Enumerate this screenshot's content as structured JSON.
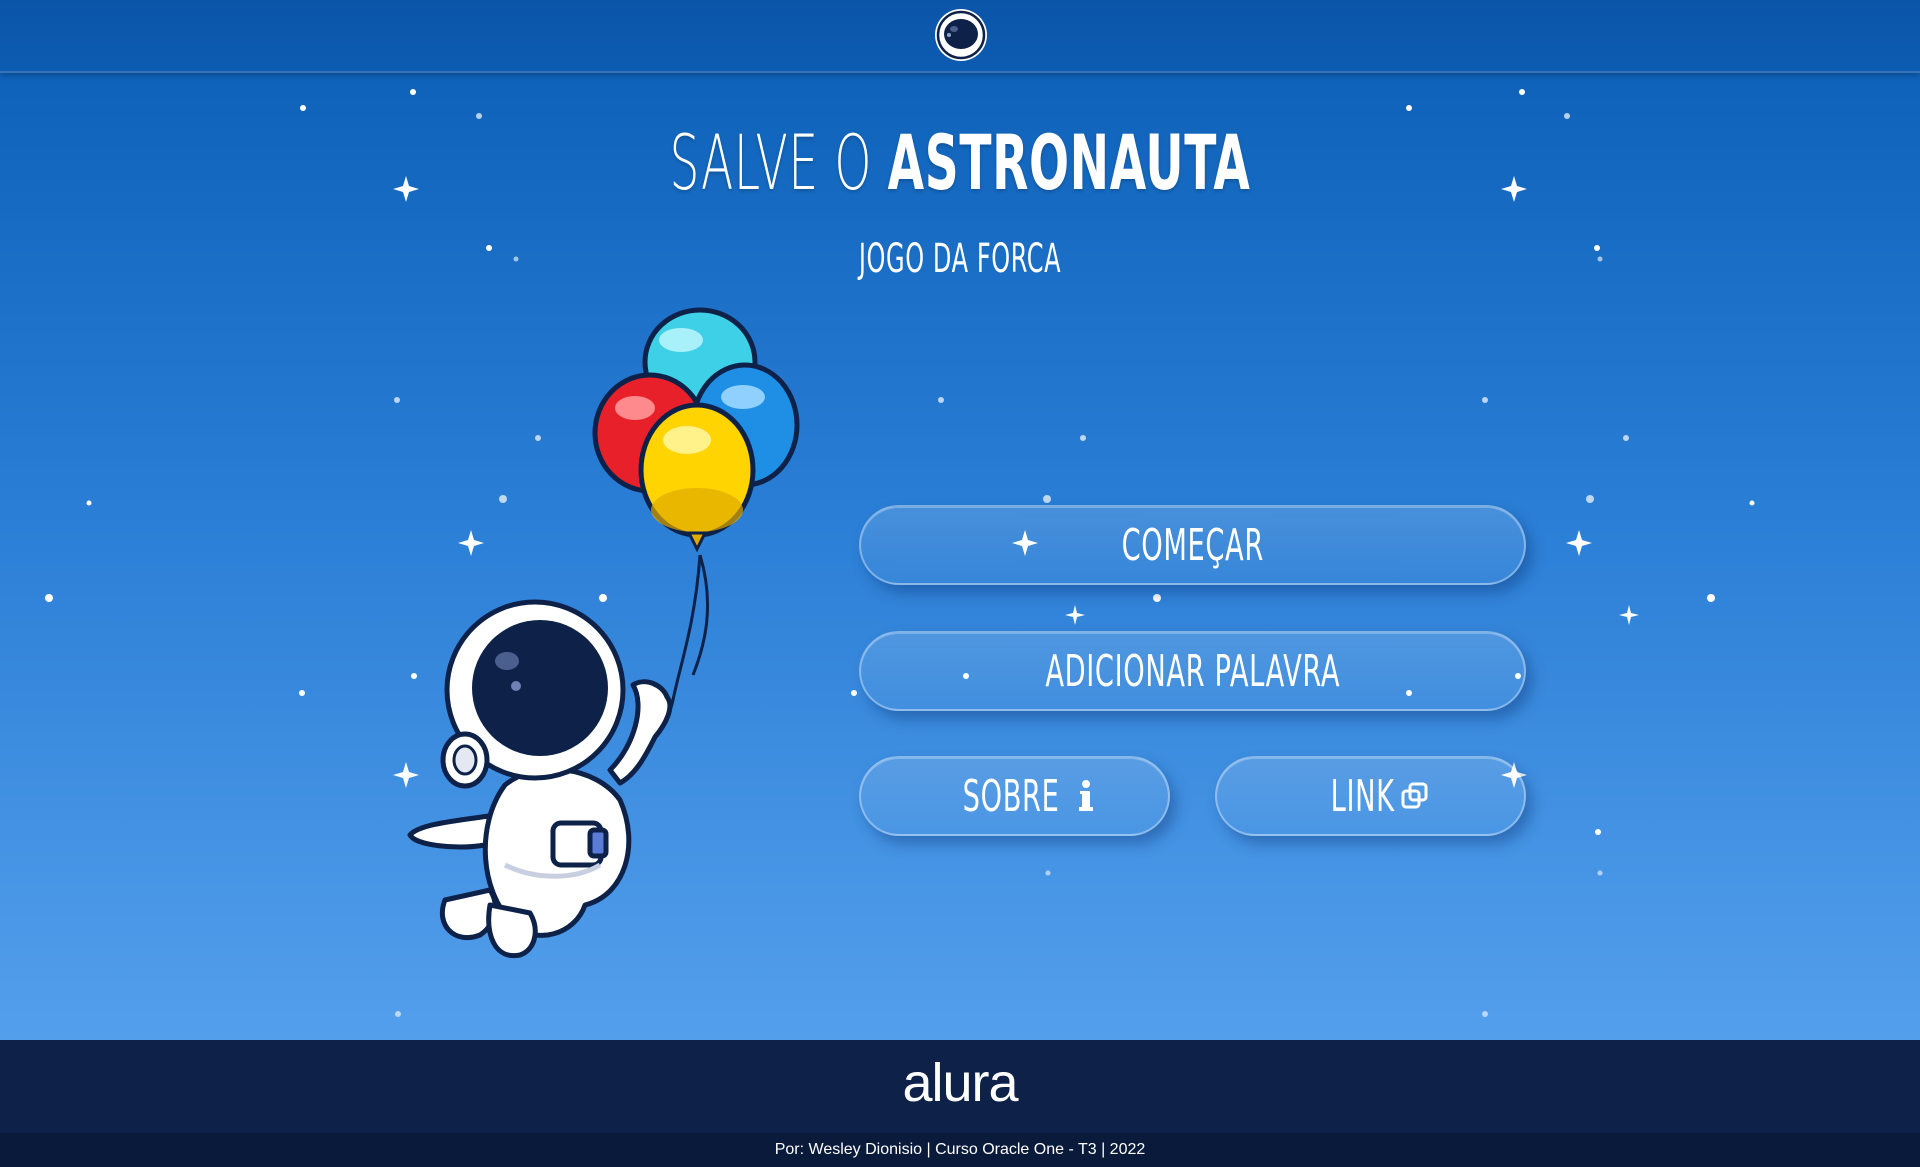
{
  "header": {
    "logo_icon": "astronaut-helmet-icon"
  },
  "hero": {
    "title_light": "SALVE O",
    "title_bold": "ASTRONAUTA",
    "subtitle": "JOGO DA FORCA",
    "illustration": "astronaut-with-balloons"
  },
  "menu": {
    "start_label": "COMEÇAR",
    "add_word_label": "ADICIONAR PALAVRA",
    "about_label": "SOBRE",
    "about_icon": "info-icon",
    "link_label": "LINK",
    "link_icon": "copy-icon"
  },
  "footer": {
    "brand": "alura",
    "credit": "Por: Wesley Dionisio | Curso Oracle One - T3 | 2022"
  },
  "colors": {
    "sky_top": "#0a5db4",
    "sky_bottom": "#5ea7f2",
    "footer_bg": "#0d2149",
    "balloon_cyan": "#3ed0e6",
    "balloon_red": "#e8202a",
    "balloon_blue": "#1f8fe6",
    "balloon_yellow": "#ffd400"
  }
}
